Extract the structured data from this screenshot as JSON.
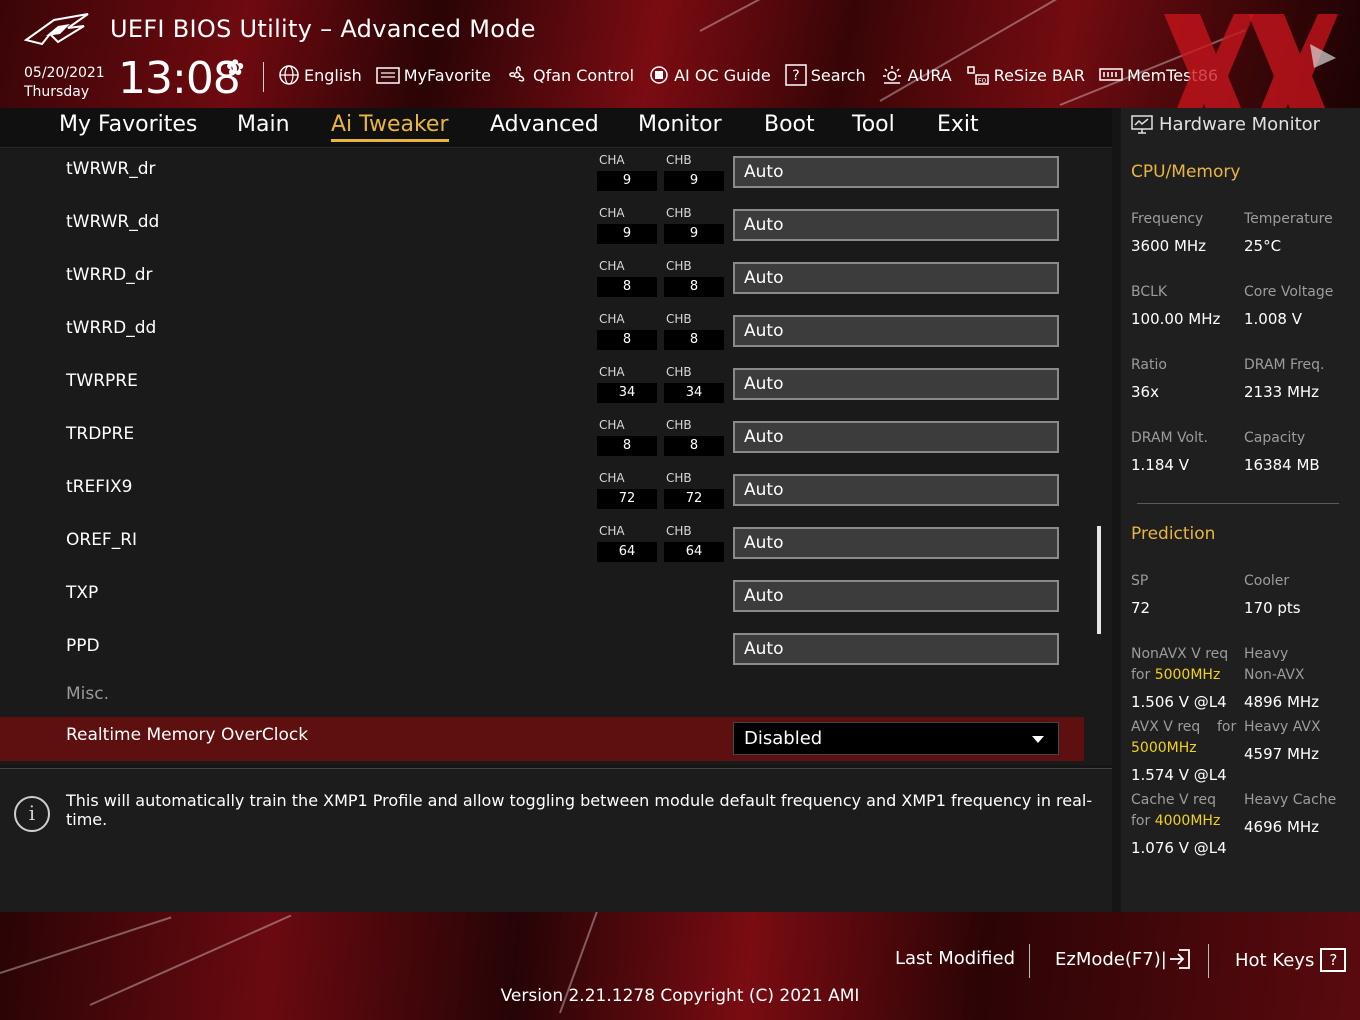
{
  "header": {
    "title": "UEFI BIOS Utility – Advanced Mode",
    "date": "05/20/2021",
    "weekday": "Thursday",
    "time": "13:08",
    "toolbar": [
      {
        "label": "English",
        "icon": "globe-icon"
      },
      {
        "label": "MyFavorite",
        "icon": "favorite-icon"
      },
      {
        "label": "Qfan Control",
        "icon": "fan-icon"
      },
      {
        "label": "AI OC Guide",
        "icon": "ai-oc-icon"
      },
      {
        "label": "Search",
        "icon": "search-icon"
      },
      {
        "label": "AURA",
        "icon": "aura-icon"
      },
      {
        "label": "ReSize BAR",
        "icon": "resize-bar-icon"
      },
      {
        "label": "MemTest86",
        "icon": "memtest-icon"
      }
    ]
  },
  "menu": {
    "tabs": [
      "My Favorites",
      "Main",
      "Ai Tweaker",
      "Advanced",
      "Monitor",
      "Boot",
      "Tool",
      "Exit"
    ],
    "active": "Ai Tweaker"
  },
  "settings": [
    {
      "label": "tWRWR_dr",
      "cha": "9",
      "chb": "9",
      "value": "Auto"
    },
    {
      "label": "tWRWR_dd",
      "cha": "9",
      "chb": "9",
      "value": "Auto"
    },
    {
      "label": "tWRRD_dr",
      "cha": "8",
      "chb": "8",
      "value": "Auto"
    },
    {
      "label": "tWRRD_dd",
      "cha": "8",
      "chb": "8",
      "value": "Auto"
    },
    {
      "label": "TWRPRE",
      "cha": "34",
      "chb": "34",
      "value": "Auto"
    },
    {
      "label": "TRDPRE",
      "cha": "8",
      "chb": "8",
      "value": "Auto"
    },
    {
      "label": "tREFIX9",
      "cha": "72",
      "chb": "72",
      "value": "Auto"
    },
    {
      "label": "OREF_RI",
      "cha": "64",
      "chb": "64",
      "value": "Auto"
    },
    {
      "label": "TXP",
      "value": "Auto"
    },
    {
      "label": "PPD",
      "value": "Auto"
    }
  ],
  "channel_labels": {
    "a": "CHA",
    "b": "CHB"
  },
  "misc_label": "Misc.",
  "realtime": {
    "label": "Realtime Memory OverClock",
    "value": "Disabled"
  },
  "info_text": "This will automatically train the XMP1 Profile and allow toggling between module default frequency and XMP1 frequency in real-time.",
  "hardware_monitor": {
    "title": "Hardware Monitor",
    "cpu_section": "CPU/Memory",
    "cpu_items": [
      {
        "label": "Frequency",
        "value": "3600 MHz"
      },
      {
        "label": "Temperature",
        "value": "25°C"
      },
      {
        "label": "BCLK",
        "value": "100.00 MHz"
      },
      {
        "label": "Core Voltage",
        "value": "1.008 V"
      },
      {
        "label": "Ratio",
        "value": "36x"
      },
      {
        "label": "DRAM Freq.",
        "value": "2133 MHz"
      },
      {
        "label": "DRAM Volt.",
        "value": "1.184 V"
      },
      {
        "label": "Capacity",
        "value": "16384 MB"
      }
    ],
    "prediction_section": "Prediction",
    "sp_label": "SP",
    "sp_value": "72",
    "cooler_label": "Cooler",
    "cooler_value": "170 pts",
    "nonavx_label": "NonAVX V req",
    "nonavx_for": "for",
    "nonavx_freq": "5000MHz",
    "nonavx_value": "1.506 V @L4",
    "heavy_nonavx_label1": "Heavy",
    "heavy_nonavx_label2": "Non-AVX",
    "heavy_nonavx_value": "4896 MHz",
    "avx_label": "AVX V req",
    "avx_for": "for",
    "avx_freq": "5000MHz",
    "avx_value": "1.574 V @L4",
    "heavy_avx_label": "Heavy AVX",
    "heavy_avx_value": "4597 MHz",
    "cache_label": "Cache V req",
    "cache_for": "for",
    "cache_freq": "4000MHz",
    "cache_value": "1.076 V @L4",
    "heavy_cache_label": "Heavy Cache",
    "heavy_cache_value": "4696 MHz"
  },
  "footer": {
    "last_modified": "Last Modified",
    "ezmode": "EzMode(F7)|",
    "hot_keys": "Hot Keys",
    "hot_keys_symbol": "?",
    "version": "Version 2.21.1278 Copyright (C) 2021 AMI"
  },
  "colors": {
    "accent": "#e8b640",
    "highlight_row": "#5e0f0f",
    "prediction_freq": "#f0d020",
    "brand_red": "#7a0c12"
  }
}
